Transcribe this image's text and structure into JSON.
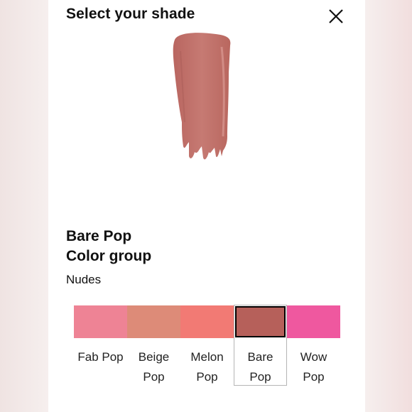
{
  "header": {
    "title": "Select your shade",
    "close_icon": "close-icon"
  },
  "product": {
    "shade_name": "Bare Pop",
    "group_label": "Color group",
    "group_value": "Nudes",
    "swatch_color": "#c0736d"
  },
  "shades": [
    {
      "line1": "Fab Pop",
      "line2": "",
      "color": "#ee8395",
      "selected": false
    },
    {
      "line1": "Beige",
      "line2": "Pop",
      "color": "#dd8b78",
      "selected": false
    },
    {
      "line1": "Melon",
      "line2": "Pop",
      "color": "#f27a74",
      "selected": false
    },
    {
      "line1": "Bare",
      "line2": "Pop",
      "color": "#b6605a",
      "selected": true
    },
    {
      "line1": "Wow",
      "line2": "Pop",
      "color": "#ef589f",
      "selected": false
    }
  ]
}
